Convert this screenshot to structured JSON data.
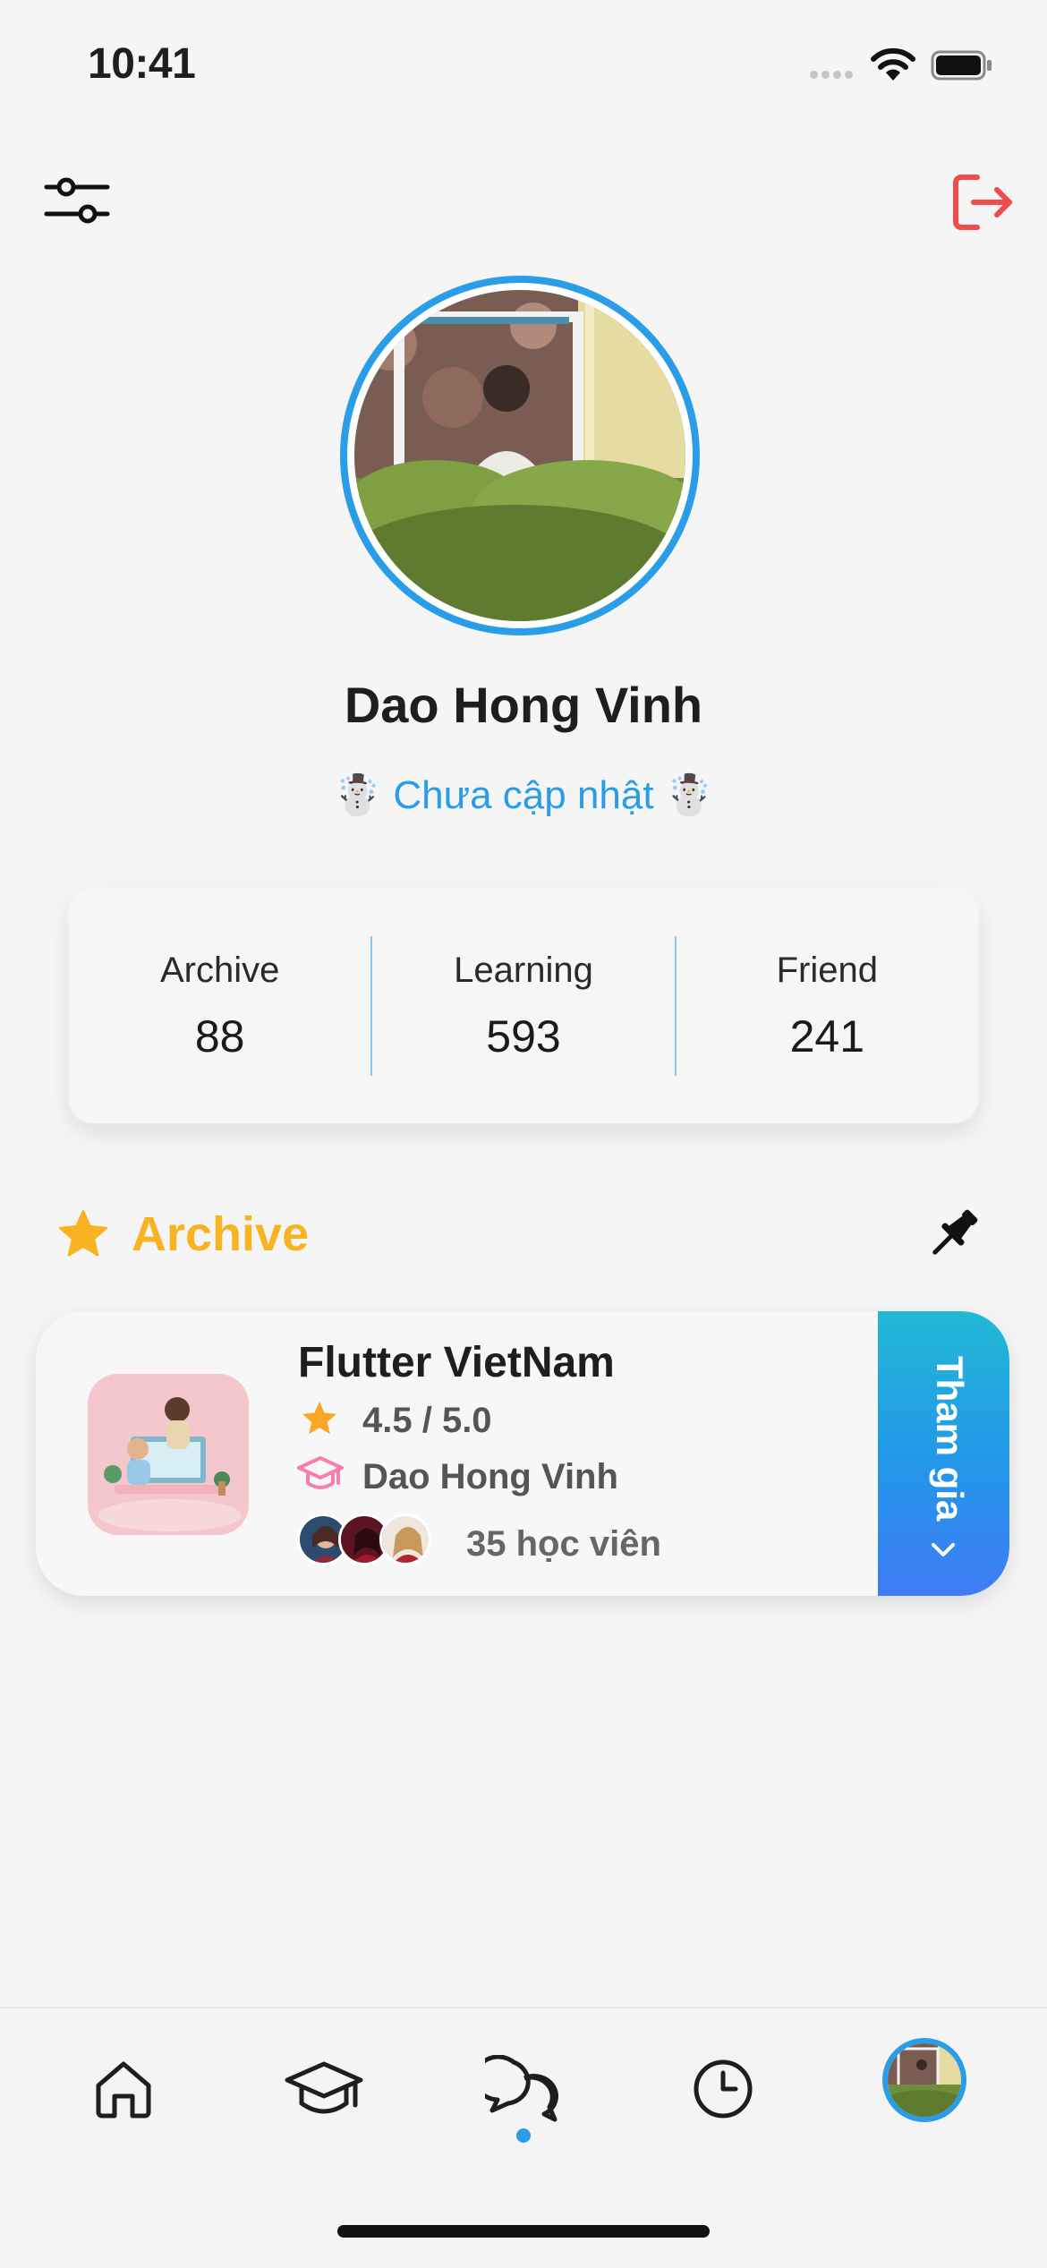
{
  "status_bar": {
    "time": "10:41"
  },
  "profile": {
    "name": "Dao Hong Vinh",
    "status": "☃️ Chưa cập nhật ☃️"
  },
  "stats": [
    {
      "label": "Archive",
      "value": "88"
    },
    {
      "label": "Learning",
      "value": "593"
    },
    {
      "label": "Friend",
      "value": "241"
    }
  ],
  "section": {
    "title": "Archive"
  },
  "course": {
    "title": "Flutter VietNam",
    "rating": "4.5 / 5.0",
    "teacher": "Dao Hong Vinh",
    "students": "35 học viên",
    "join_label": "Tham gia"
  },
  "nav": {
    "items": [
      "home-icon",
      "graduation-cap-icon",
      "chat-bubbles-icon",
      "clock-icon",
      "profile-avatar"
    ],
    "active_index": 2
  },
  "colors": {
    "accent": "#2a9de8",
    "section_accent": "#f9b320",
    "logout": "#f04c4c",
    "teacher_icon": "#f57fb1"
  }
}
